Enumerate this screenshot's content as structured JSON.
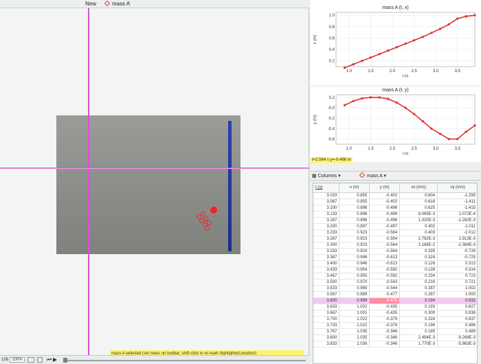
{
  "toolbar": {
    "new_label": "New",
    "mass_label": "mass A"
  },
  "status_message": "mass A selected (set mass on toolbar, shift-click to re-mark highlighted position)",
  "player": {
    "frame": "108",
    "zoom": "100%"
  },
  "colors": {
    "accent": "#d453d6",
    "point": "#e53030",
    "highlight": "#fff36a"
  },
  "plot_xt": {
    "title": "mass A (t, x)",
    "ylabel": "x (m)",
    "xlabel": "t (s)",
    "yticks": [
      "1.0",
      "0.8",
      "0.6",
      "0.4",
      "0.2"
    ],
    "xticks": [
      "1.0",
      "1.5",
      "2.0",
      "2.5",
      "3.0",
      "3.5"
    ]
  },
  "plot_yt": {
    "title": "mass A (t, y)",
    "ylabel": "y (m)",
    "xlabel": "t (s)",
    "yticks": [
      "0.2",
      "-0.0",
      "-0.2",
      "-0.4",
      "-0.6"
    ],
    "xticks": [
      "1.0",
      "1.5",
      "2.0",
      "2.5",
      "3.0",
      "3.5"
    ]
  },
  "readout": "t=2.564 s  y=-0.486 m",
  "table_toolbar": {
    "columns_label": "Columns",
    "mass_label": "mass A"
  },
  "table": {
    "headers": [
      "t (s)",
      "x (m)",
      "y (m)",
      "vx (m/s)",
      "vy (m/s)"
    ],
    "rows": [
      [
        "3.033",
        "0.855",
        "-0.402",
        "0.604",
        "-1.295"
      ],
      [
        "3.067",
        "0.855",
        "-0.402",
        "0.618",
        "-1.411"
      ],
      [
        "3.100",
        "0.896",
        "-0.496",
        "0.625",
        "-1.415"
      ],
      [
        "3.133",
        "0.896",
        "-0.496",
        "8.065E-3",
        "1.072E-4"
      ],
      [
        "3.167",
        "0.896",
        "-0.496",
        "1.320E-3",
        "-1.282E-3"
      ],
      [
        "3.200",
        "0.897",
        "-0.497",
        "0.402",
        "-1.011"
      ],
      [
        "3.233",
        "0.923",
        "-0.564",
        "0.403",
        "-1.012"
      ],
      [
        "3.267",
        "0.923",
        "-0.564",
        "2.782E-3",
        "2.913E-3"
      ],
      [
        "3.300",
        "0.923",
        "-0.564",
        "1.166E-2",
        "-2.384E-3"
      ],
      [
        "3.333",
        "0.924",
        "-0.564",
        "0.335",
        "-0.728"
      ],
      [
        "3.367",
        "0.946",
        "-0.613",
        "0.324",
        "-0.725"
      ],
      [
        "3.400",
        "0.946",
        "-0.613",
        "0.126",
        "0.313"
      ],
      [
        "3.433",
        "0.954",
        "-0.592",
        "0.139",
        "0.314"
      ],
      [
        "3.467",
        "0.955",
        "-0.592",
        "0.234",
        "0.723"
      ],
      [
        "3.500",
        "0.970",
        "-0.543",
        "0.216",
        "0.721"
      ],
      [
        "3.533",
        "0.969",
        "-0.544",
        "0.287",
        "1.002"
      ],
      [
        "3.567",
        "0.989",
        "-0.477",
        "0.287",
        "1.000"
      ],
      [
        "3.600",
        "0.989",
        "-0.476",
        "0.194",
        "0.632"
      ],
      [
        "3.633",
        "1.002",
        "-0.435",
        "0.193",
        "0.627"
      ],
      [
        "3.667",
        "1.001",
        "-0.435",
        "0.309",
        "0.836"
      ],
      [
        "3.700",
        "1.022",
        "-0.379",
        "0.316",
        "0.837"
      ],
      [
        "3.733",
        "1.022",
        "-0.379",
        "0.196",
        "0.496"
      ],
      [
        "3.767",
        "1.035",
        "-0.346",
        "0.195",
        "0.489"
      ],
      [
        "3.800",
        "1.035",
        "-0.346",
        "2.494E-3",
        "-9.268E-3"
      ],
      [
        "3.833",
        "1.036",
        "-0.346",
        "1.770E-3",
        "-5.863E-3"
      ]
    ],
    "highlight_row": 17
  },
  "chart_data": [
    {
      "type": "line",
      "title": "mass A (t, x)",
      "xlabel": "t (s)",
      "ylabel": "x (m)",
      "xlim": [
        0.7,
        3.9
      ],
      "ylim": [
        0.1,
        1.05
      ],
      "series": [
        {
          "x": [
            0.9,
            1.1,
            1.3,
            1.5,
            1.7,
            1.9,
            2.1,
            2.3,
            2.5,
            2.7,
            2.9,
            3.1,
            3.3,
            3.5,
            3.7,
            3.9
          ],
          "values": [
            0.08,
            0.14,
            0.2,
            0.26,
            0.32,
            0.38,
            0.44,
            0.5,
            0.56,
            0.62,
            0.69,
            0.76,
            0.84,
            0.94,
            0.98,
            1.0
          ]
        }
      ]
    },
    {
      "type": "line",
      "title": "mass A (t, y)",
      "xlabel": "t (s)",
      "ylabel": "y (m)",
      "xlim": [
        0.7,
        3.9
      ],
      "ylim": [
        -0.7,
        0.25
      ],
      "series": [
        {
          "x": [
            0.9,
            1.1,
            1.3,
            1.5,
            1.7,
            1.9,
            2.1,
            2.3,
            2.5,
            2.7,
            2.9,
            3.1,
            3.3,
            3.5,
            3.7,
            3.9
          ],
          "values": [
            0.05,
            0.13,
            0.18,
            0.2,
            0.2,
            0.17,
            0.1,
            0.0,
            -0.12,
            -0.26,
            -0.4,
            -0.5,
            -0.6,
            -0.6,
            -0.46,
            -0.34
          ]
        }
      ]
    }
  ]
}
